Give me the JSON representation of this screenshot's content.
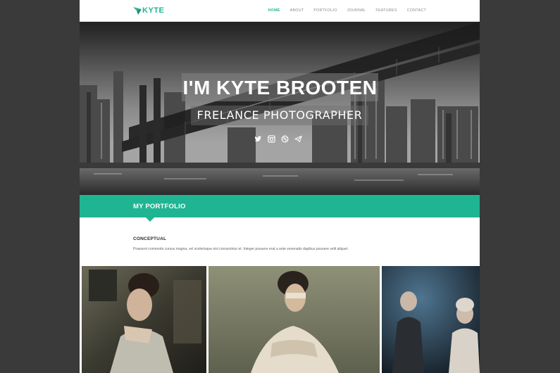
{
  "brand": {
    "name": "KYTE",
    "accent": "#1fb592"
  },
  "nav": [
    {
      "label": "HOME",
      "active": true
    },
    {
      "label": "ABOUT"
    },
    {
      "label": "PORTFOLIO"
    },
    {
      "label": "JOURNAL"
    },
    {
      "label": "FEATURES"
    },
    {
      "label": "CONTACT"
    }
  ],
  "hero": {
    "title": "I'M KYTE BROOTEN",
    "subtitle": "FRELANCE PHOTOGRAPHER",
    "social_icons": [
      "twitter-icon",
      "instagram-icon",
      "dribbble-icon",
      "paper-plane-icon"
    ]
  },
  "portfolio": {
    "section_title": "MY PORTFOLIO",
    "category_title": "CONCEPTUAL",
    "category_desc": "Praesent commodo cursus magna, vel scelerisque nisl consectetur et. Integer posuere erat a ante venenatis dapibus posuere velit aliquet."
  },
  "colors": {
    "page_bg": "#3a3a3a",
    "band": "#1fb592",
    "header_bg": "#ffffff"
  }
}
